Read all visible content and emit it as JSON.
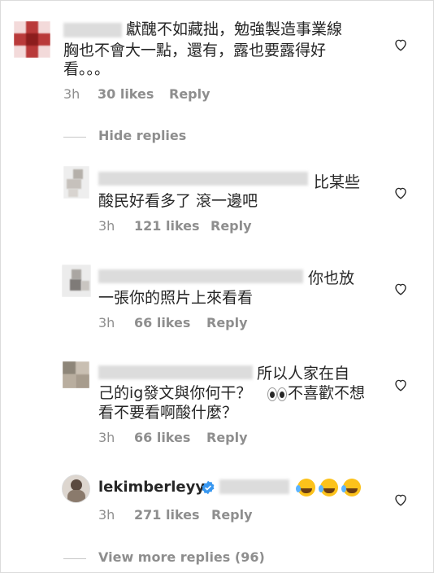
{
  "comments": [
    {
      "text": "獻醜不如藏拙，勉強製造事業線胸也不會大一點，還有，露也要露得好看。。。",
      "line1": "獻醜不如藏拙，勉強製造事業線",
      "line2": "胸也不會大一點，還有，露也要露得好",
      "line3": "看。。。",
      "time": "3h",
      "likes": "30 likes",
      "reply": "Reply"
    },
    {
      "text": "比某些酸民好看多了 滾一邊吧",
      "line1": "比某些",
      "line2": "酸民好看多了 滾一邊吧",
      "time": "3h",
      "likes": "121 likes",
      "reply": "Reply"
    },
    {
      "text": "你也放一張你的照片上來看看",
      "line1": "你也放",
      "line2": "一張你的照片上來看看",
      "time": "3h",
      "likes": "66 likes",
      "reply": "Reply"
    },
    {
      "text": "所以人家在自己的ig發文與你何干？👀不喜歡不想看不要看啊酸什麼？",
      "line1": "所以人家在自",
      "line2": "己的ig發文與你何干？",
      "line2b": "不喜歡不想",
      "line3": "看不要看啊酸什麼？",
      "emoji": "eyes-emoji",
      "time": "3h",
      "likes": "66 likes",
      "reply": "Reply"
    },
    {
      "username": "lekimberleyy",
      "verified": true,
      "emoji": "laughing-crying-emoji",
      "time": "3h",
      "likes": "271 likes",
      "reply": "Reply"
    }
  ],
  "hide_replies": "Hide replies",
  "view_more": "View more replies (96)",
  "colors": {
    "text": "#262626",
    "meta": "#8e8e8e",
    "verified": "#3897f0",
    "blur": "#dcdcdc"
  }
}
